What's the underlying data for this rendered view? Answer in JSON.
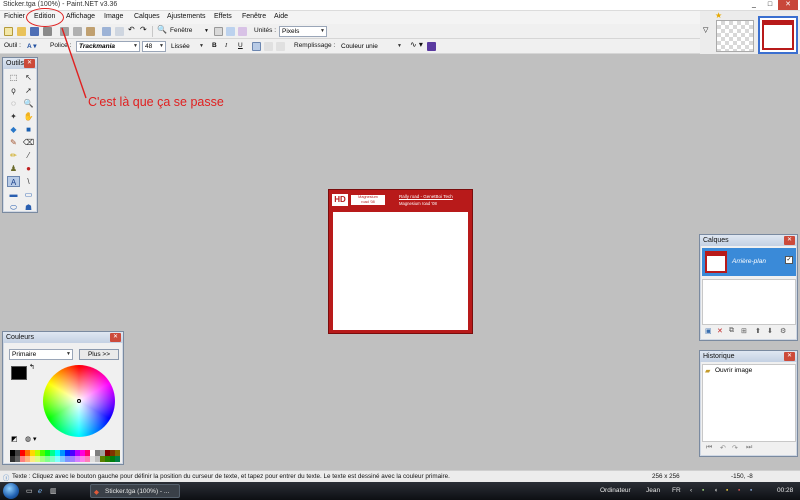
{
  "window": {
    "title": "Sticker.tga (100%) - Paint.NET v3.36"
  },
  "menu": [
    "Fichier",
    "Edition",
    "Affichage",
    "Image",
    "Calques",
    "Ajustements",
    "Effets",
    "Fenêtre",
    "Aide"
  ],
  "toolbar1": {
    "window_combo": "Fenêtre",
    "units_label": "Unités :",
    "units_value": "Pixels"
  },
  "toolbar2": {
    "tool_label": "Outil :",
    "font_label": "Police :",
    "font_value": "Trackmania",
    "size_value": "48",
    "antialias_value": "Lissée",
    "bold": "B",
    "italic": "I",
    "underline": "U",
    "fill_label": "Remplissage :",
    "fill_value": "Couleur unie"
  },
  "annotation": {
    "text": "C'est là que ça se passe",
    "color": "#e02020"
  },
  "image": {
    "badge": "HD",
    "logo_line1": "Magnesium",
    "logo_line2": "road '08",
    "right_line1": "Rally road - GenetBoi Tech",
    "right_line2": "Magnesium road '08"
  },
  "tools_panel": {
    "title": "Outils"
  },
  "colors_panel": {
    "title": "Couleurs",
    "mode": "Primaire",
    "more_button": "Plus >>"
  },
  "layers_panel": {
    "title": "Calques",
    "layer_name": "Arrière-plan"
  },
  "history_panel": {
    "title": "Historique",
    "item": "Ouvrir image"
  },
  "statusbar": {
    "hint": "Texte : Cliquez avec le bouton gauche pour définir la position du curseur de texte, et tapez pour entrer du texte. Le texte est dessiné avec la couleur primaire.",
    "size": "256 x 256",
    "coords": "-150, -8"
  },
  "taskbar": {
    "task": "Sticker.tga (100%) - ...",
    "computer": "Ordinateur",
    "user": "Jean",
    "lang": "FR",
    "time": "00:28"
  },
  "colors": {
    "accent_red": "#b81a1a",
    "canvas_bg": "#c0c0c0",
    "annotation": "#e02020"
  }
}
